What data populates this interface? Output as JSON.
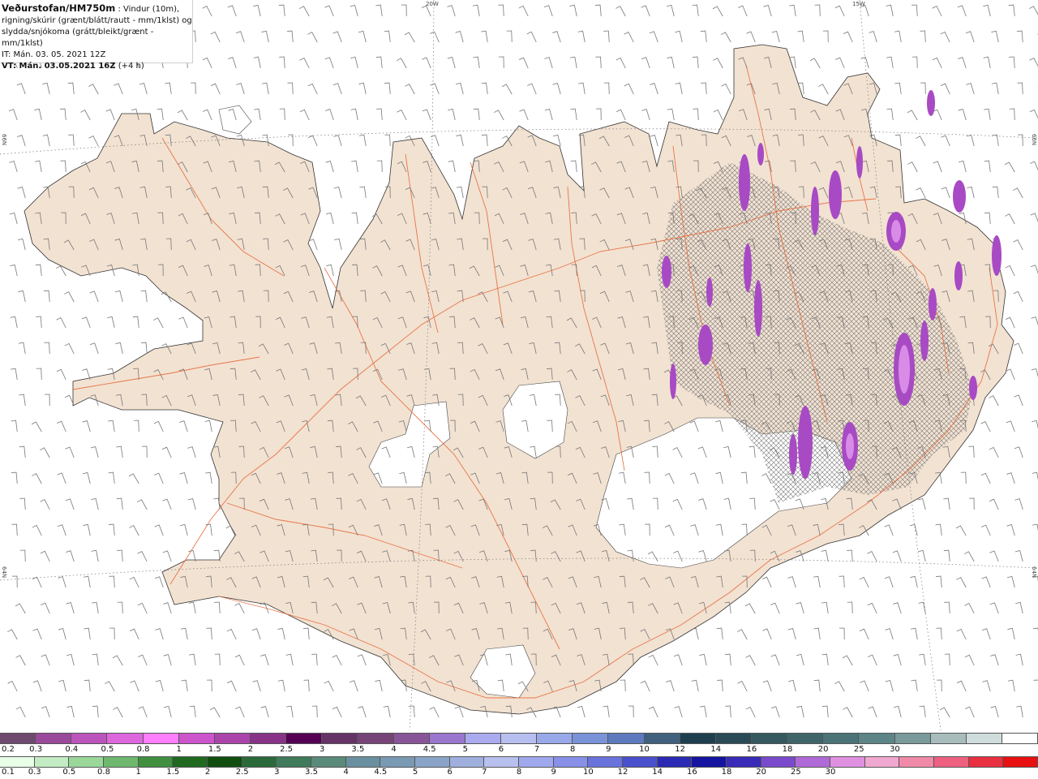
{
  "header": {
    "title": "Veðurstofan/HM750m",
    "title_suffix": " : Vindur (10m),",
    "line2": "rigning/skúrir (grænt/blátt/rautt - mm/1klst) og",
    "line3": "slydda/snjókoma (grátt/bleikt/grænt - mm/1klst)",
    "it": "IT: Mán. 03. 05. 2021 12Z",
    "vt_label": "VT: Mán. 03.05.2021 16Z",
    "vt_suffix": " (+4 h)"
  },
  "grid_labels": {
    "lon_20w": "20W",
    "lon_15w": "15W",
    "lat_66n_left": "66N",
    "lat_66n_right": "66N",
    "lat_64n_left": "64N",
    "lat_64n_right": "64N"
  },
  "colors": {
    "land": "#f2e2d2",
    "roads": "#e86a3a",
    "glacier": "#ffffff",
    "snow_core": "#a84ac4",
    "snow_light": "#d98be8",
    "wind_barb": "#777777"
  },
  "legend_snow": {
    "colors": [
      "#6e4a6e",
      "#9a4a9a",
      "#bb55bb",
      "#dd66dd",
      "#ff7fff",
      "#cc55cc",
      "#aa44aa",
      "#883388",
      "#550055",
      "#663366",
      "#774477",
      "#885599",
      "#9a77cc",
      "#aaaaee",
      "#b7bff0",
      "#98a8e8",
      "#7a92d8",
      "#5e7abe",
      "#40607e",
      "#1f3f4f",
      "#2a4b56",
      "#35595f",
      "#3f656a",
      "#4b7378",
      "#5d8588",
      "#7a9a9c",
      "#a8bcbc",
      "#cfdcdc",
      "#ffffff"
    ],
    "labels": [
      "0.2",
      "0.3",
      "0.4",
      "0.5",
      "0.8",
      "1",
      "1.5",
      "2",
      "2.5",
      "3",
      "3.5",
      "4",
      "4.5",
      "5",
      "6",
      "7",
      "8",
      "9",
      "10",
      "12",
      "14",
      "16",
      "18",
      "20",
      "25",
      "30"
    ]
  },
  "legend_rain": {
    "colors": [
      "#e8ffe8",
      "#c4ecc4",
      "#9ad89a",
      "#6eb86e",
      "#3f8f3f",
      "#1f6a1f",
      "#104e10",
      "#2a6a3a",
      "#3f7a5a",
      "#5a8a7a",
      "#6a90a0",
      "#7a9ab4",
      "#8aa4c8",
      "#a0b0de",
      "#b8c0f0",
      "#a0a8ee",
      "#8890e8",
      "#6a72dc",
      "#4a50cc",
      "#2a2ab4",
      "#1414a0",
      "#3a2ab8",
      "#7a4acc",
      "#b06ad8",
      "#e090e0",
      "#f0a8d0",
      "#f08aa8",
      "#ee6080",
      "#e83040",
      "#e81010"
    ],
    "labels": [
      "0.1",
      "0.3",
      "0.5",
      "0.8",
      "1",
      "1.5",
      "2",
      "2.5",
      "3",
      "3.5",
      "4",
      "4.5",
      "5",
      "6",
      "7",
      "8",
      "9",
      "10",
      "12",
      "14",
      "16",
      "18",
      "20",
      "25",
      "30"
    ]
  }
}
